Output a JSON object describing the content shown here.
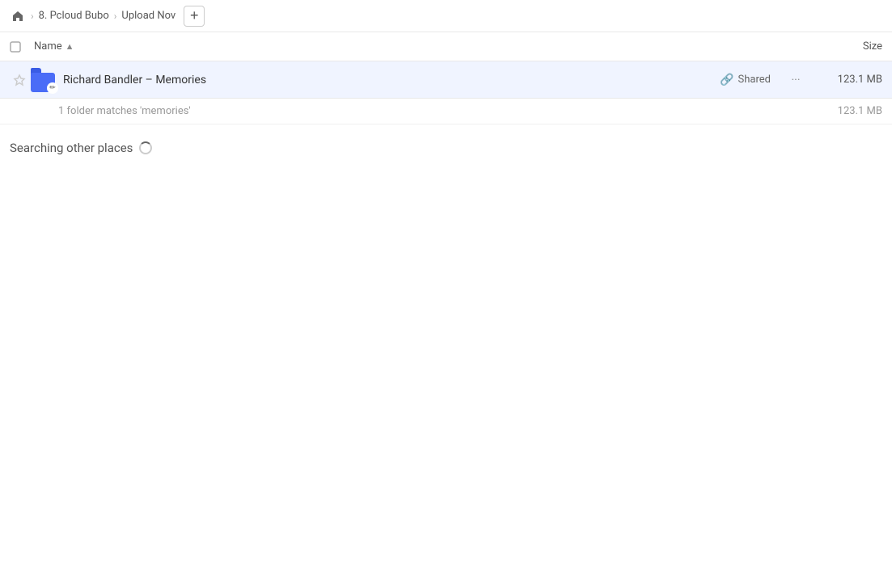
{
  "breadcrumb": {
    "home_label": "home",
    "items": [
      {
        "label": "8. Pcloud Bubo"
      },
      {
        "label": "Upload Nov"
      }
    ],
    "add_button_label": "+"
  },
  "column_header": {
    "name_label": "Name",
    "sort_indicator": "▲",
    "size_label": "Size"
  },
  "file_row": {
    "name": "Richard Bandler – Memories",
    "shared_label": "Shared",
    "size": "123.1 MB",
    "more_icon": "···"
  },
  "match_info": {
    "text": "1 folder matches 'memories'",
    "size": "123.1 MB"
  },
  "searching": {
    "label": "Searching other places"
  }
}
